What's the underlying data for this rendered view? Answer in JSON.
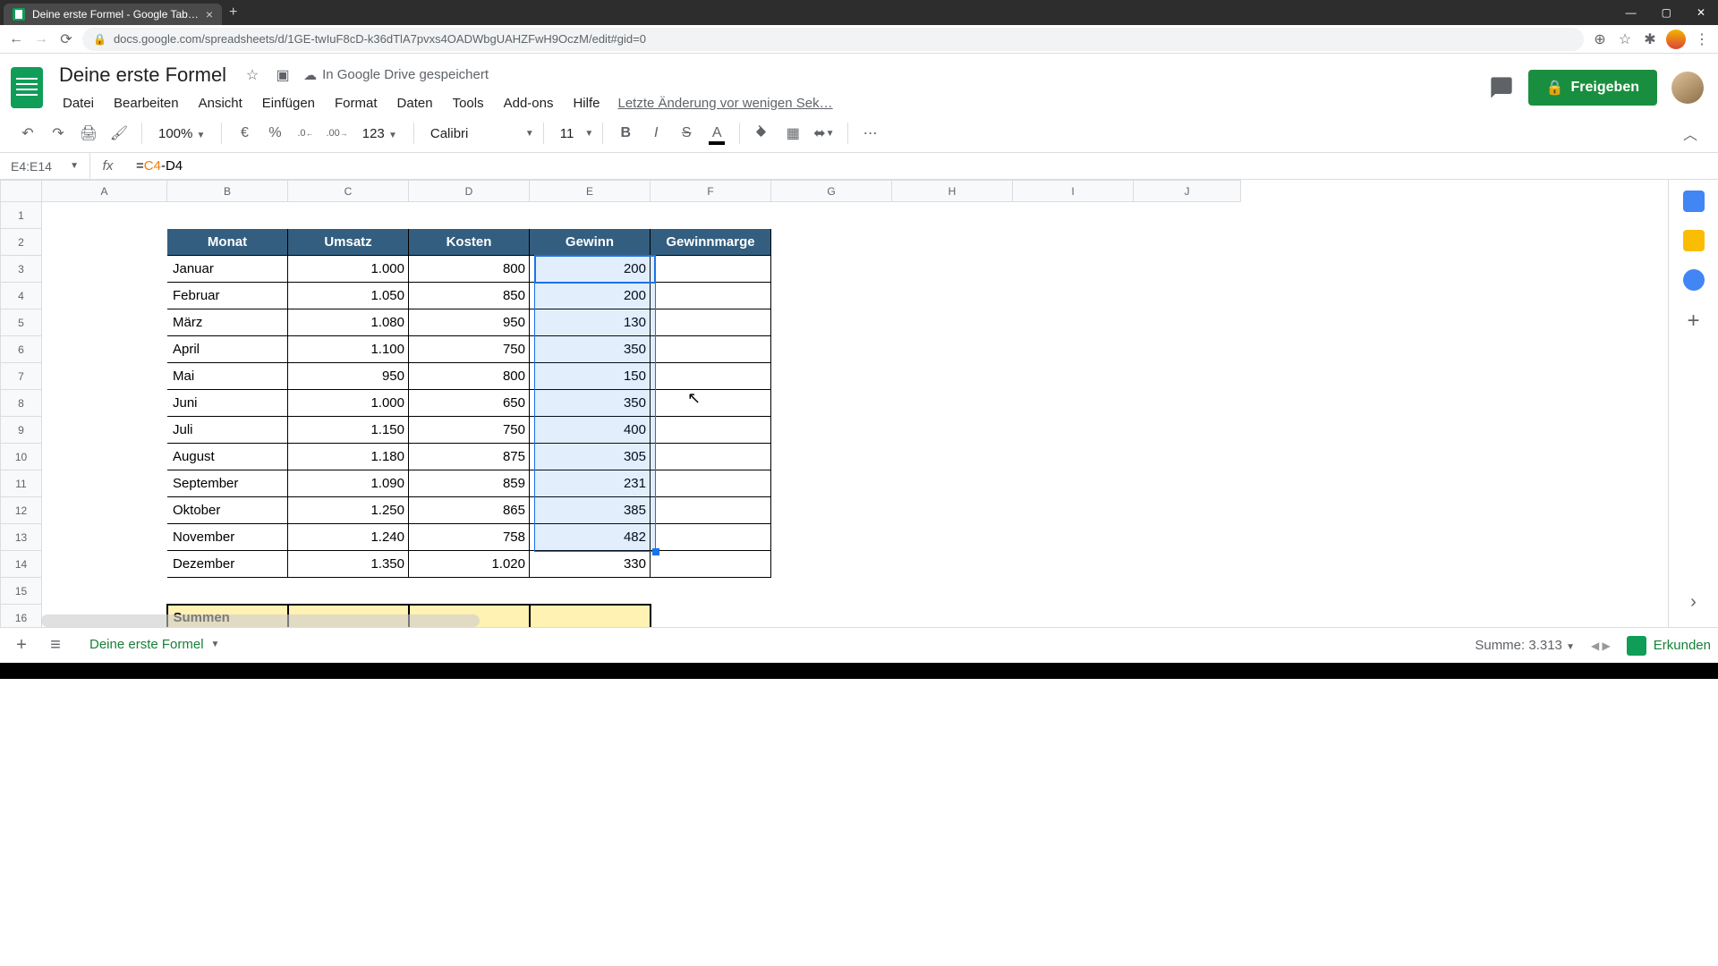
{
  "browser": {
    "tab_title": "Deine erste Formel - Google Tab…",
    "url": "docs.google.com/spreadsheets/d/1GE-twIuF8cD-k36dTlA7pvxs4OADWbgUAHZFwH9OczM/edit#gid=0"
  },
  "doc": {
    "title": "Deine erste Formel",
    "drive_status": "In Google Drive gespeichert",
    "last_edit": "Letzte Änderung vor wenigen Sek…",
    "share_label": "Freigeben"
  },
  "menu": {
    "file": "Datei",
    "edit": "Bearbeiten",
    "view": "Ansicht",
    "insert": "Einfügen",
    "format": "Format",
    "data": "Daten",
    "tools": "Tools",
    "addons": "Add-ons",
    "help": "Hilfe"
  },
  "toolbar": {
    "zoom": "100%",
    "currency": "€",
    "percent": "%",
    "dec_dec": ".0",
    "inc_dec": ".00",
    "num_format": "123",
    "font": "Calibri",
    "font_size": "11",
    "more": "⋯"
  },
  "formula": {
    "name_box": "E4:E14",
    "content": "=C4-D4",
    "eq": "=",
    "ref1": "C4",
    "op": "-",
    "ref2": "D4"
  },
  "columns": [
    "A",
    "B",
    "C",
    "D",
    "E",
    "F",
    "G",
    "H",
    "I",
    "J"
  ],
  "headers": {
    "monat": "Monat",
    "umsatz": "Umsatz",
    "kosten": "Kosten",
    "gewinn": "Gewinn",
    "marge": "Gewinnmarge"
  },
  "rows": [
    {
      "n": "1"
    },
    {
      "n": "2"
    },
    {
      "n": "3"
    },
    {
      "n": "4"
    },
    {
      "n": "5"
    },
    {
      "n": "6"
    },
    {
      "n": "7"
    },
    {
      "n": "8"
    },
    {
      "n": "9"
    },
    {
      "n": "10"
    },
    {
      "n": "11"
    },
    {
      "n": "12"
    },
    {
      "n": "13"
    },
    {
      "n": "14"
    },
    {
      "n": "15"
    },
    {
      "n": "16"
    }
  ],
  "data": [
    {
      "monat": "Januar",
      "umsatz": "1.000",
      "kosten": "800",
      "gewinn": "200"
    },
    {
      "monat": "Februar",
      "umsatz": "1.050",
      "kosten": "850",
      "gewinn": "200"
    },
    {
      "monat": "März",
      "umsatz": "1.080",
      "kosten": "950",
      "gewinn": "130"
    },
    {
      "monat": "April",
      "umsatz": "1.100",
      "kosten": "750",
      "gewinn": "350"
    },
    {
      "monat": "Mai",
      "umsatz": "950",
      "kosten": "800",
      "gewinn": "150"
    },
    {
      "monat": "Juni",
      "umsatz": "1.000",
      "kosten": "650",
      "gewinn": "350"
    },
    {
      "monat": "Juli",
      "umsatz": "1.150",
      "kosten": "750",
      "gewinn": "400"
    },
    {
      "monat": "August",
      "umsatz": "1.180",
      "kosten": "875",
      "gewinn": "305"
    },
    {
      "monat": "September",
      "umsatz": "1.090",
      "kosten": "859",
      "gewinn": "231"
    },
    {
      "monat": "Oktober",
      "umsatz": "1.250",
      "kosten": "865",
      "gewinn": "385"
    },
    {
      "monat": "November",
      "umsatz": "1.240",
      "kosten": "758",
      "gewinn": "482"
    },
    {
      "monat": "Dezember",
      "umsatz": "1.350",
      "kosten": "1.020",
      "gewinn": "330"
    }
  ],
  "summen_label": "Summen",
  "footer": {
    "sheet_name": "Deine erste Formel",
    "stats": "Summe: 3.313",
    "explore": "Erkunden"
  }
}
